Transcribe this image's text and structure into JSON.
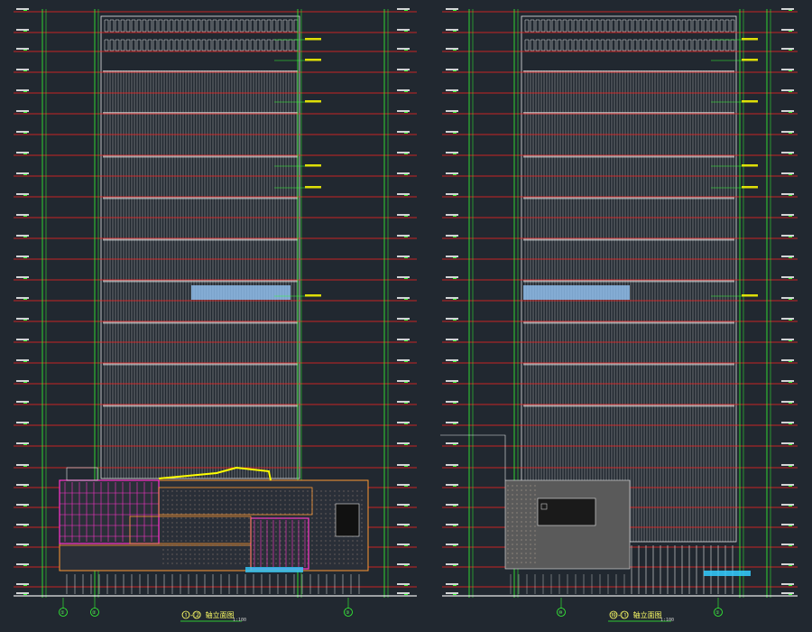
{
  "drawing": {
    "colors": {
      "background": "#212830",
      "floor_line": "#ff2222",
      "dim_line": "#33ff33",
      "dim_text": "#ffffff",
      "facade": "#e8e8e8",
      "podium_pink": "#ff33cc",
      "podium_orange": "#ff9933",
      "canopy_yellow": "#ffff00",
      "glass_blue": "#99ccff",
      "canopy_cyan": "#33ccff",
      "grey_mass": "#5a5a5a"
    },
    "elevations": [
      {
        "name": "left-elevation",
        "title": "①-② 轴立面图",
        "grid_bubbles": [
          "①",
          "②",
          "③"
        ],
        "scale_note": "1:100"
      },
      {
        "name": "right-elevation",
        "title": "⑩-① 轴立面图",
        "grid_bubbles": [
          "⑩",
          "①"
        ],
        "scale_note": "1:100"
      }
    ]
  }
}
